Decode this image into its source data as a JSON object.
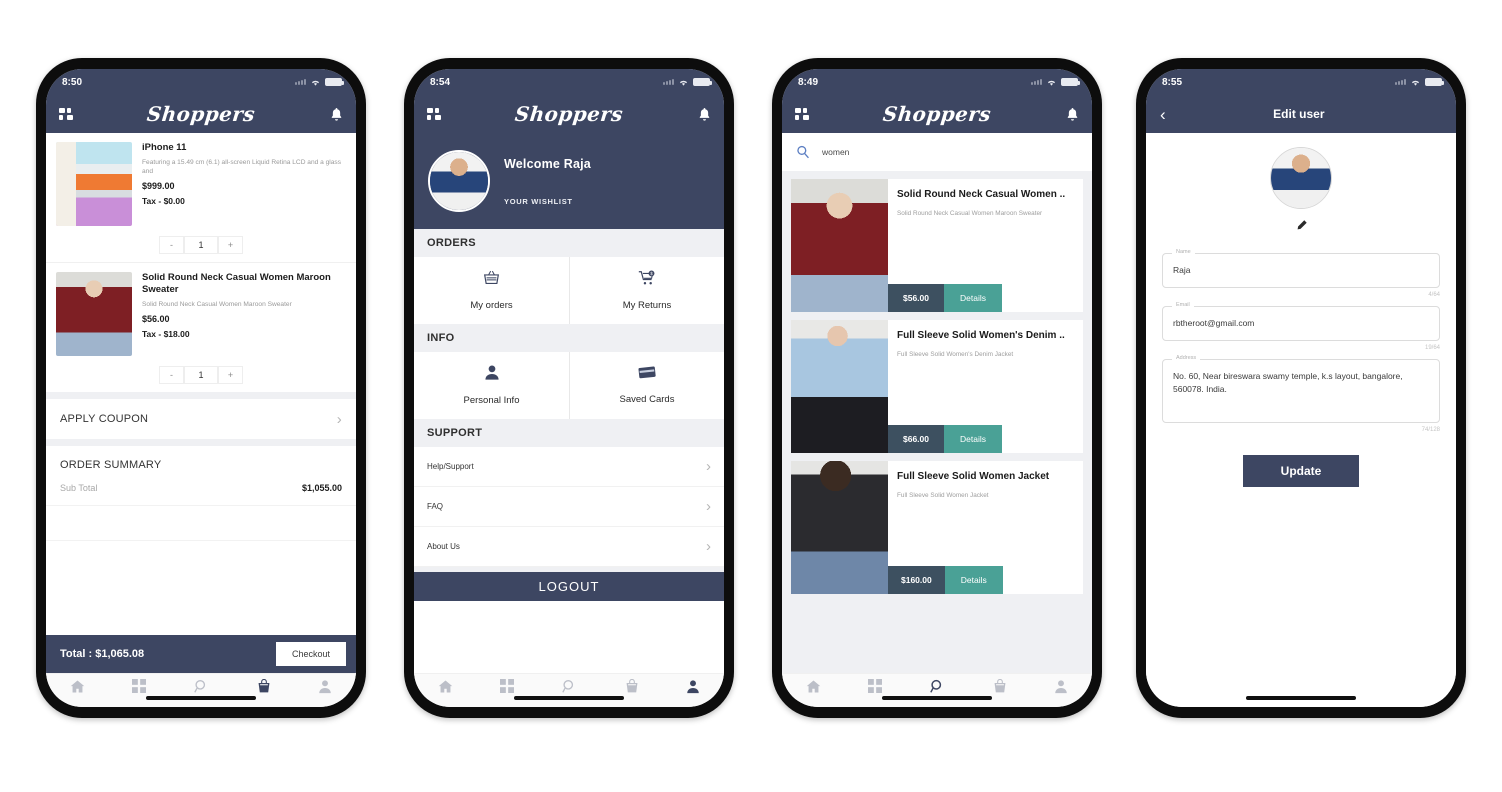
{
  "phones": [
    {
      "id": "cart",
      "status": {
        "time": "8:50",
        "wifi_icon": "wifi-icon",
        "battery_icon": "battery-icon",
        "signal_icon": "signal-icon"
      },
      "header": {
        "menu_icon": "grid-menu-icon",
        "logo": "Shoppers",
        "bell_icon": "notification-bell-icon"
      },
      "items": [
        {
          "title": "iPhone 11",
          "desc": "Featuring a 15.49 cm (6.1) all-screen Liquid Retina LCD and a glass and",
          "price": "$999.00",
          "tax": "Tax - $0.00",
          "qty": "1",
          "minus": "-",
          "plus": "+"
        },
        {
          "title": "Solid Round Neck Casual Women Maroon Sweater",
          "desc": "Solid Round Neck Casual Women Maroon Sweater",
          "price": "$56.00",
          "tax": "Tax - $18.00",
          "qty": "1",
          "minus": "-",
          "plus": "+"
        }
      ],
      "coupon_label": "APPLY COUPON",
      "summary_title": "ORDER SUMMARY",
      "summary_rows": [
        {
          "label": "Sub Total",
          "value": "$1,055.00"
        }
      ],
      "total_label": "Total : $1,065.08",
      "checkout_label": "Checkout",
      "tabs": [
        {
          "name": "home",
          "icon": "home-icon",
          "active": false
        },
        {
          "name": "categories",
          "icon": "grid-icon",
          "active": false
        },
        {
          "name": "search",
          "icon": "search-icon",
          "active": false
        },
        {
          "name": "cart",
          "icon": "cart-icon",
          "active": true
        },
        {
          "name": "profile",
          "icon": "person-icon",
          "active": false
        }
      ]
    },
    {
      "id": "profile",
      "status": {
        "time": "8:54",
        "wifi_icon": "wifi-icon",
        "battery_icon": "battery-icon",
        "signal_icon": "signal-icon"
      },
      "header": {
        "menu_icon": "grid-menu-icon",
        "logo": "Shoppers",
        "bell_icon": "notification-bell-icon"
      },
      "welcome": "Welcome Raja",
      "wishlist": "YOUR WISHLIST",
      "groups": [
        {
          "title": "ORDERS",
          "tiles": [
            {
              "label": "My orders",
              "icon": "basket-icon"
            },
            {
              "label": "My Returns",
              "icon": "return-cart-icon"
            }
          ]
        },
        {
          "title": "INFO",
          "tiles": [
            {
              "label": "Personal Info",
              "icon": "person-icon"
            },
            {
              "label": "Saved Cards",
              "icon": "credit-card-icon"
            }
          ]
        }
      ],
      "support_title": "SUPPORT",
      "support_rows": [
        {
          "label": "Help/Support"
        },
        {
          "label": "FAQ"
        },
        {
          "label": "About Us"
        }
      ],
      "logout_label": "LOGOUT",
      "tabs": [
        {
          "name": "home",
          "icon": "home-icon",
          "active": false
        },
        {
          "name": "categories",
          "icon": "grid-icon",
          "active": false
        },
        {
          "name": "search",
          "icon": "search-icon",
          "active": false
        },
        {
          "name": "cart",
          "icon": "cart-icon",
          "active": false
        },
        {
          "name": "profile",
          "icon": "person-icon",
          "active": true
        }
      ]
    },
    {
      "id": "search",
      "status": {
        "time": "8:49",
        "wifi_icon": "wifi-icon",
        "battery_icon": "battery-icon",
        "signal_icon": "signal-icon"
      },
      "header": {
        "menu_icon": "grid-menu-icon",
        "logo": "Shoppers",
        "bell_icon": "notification-bell-icon"
      },
      "search": {
        "icon": "search-icon",
        "value": "women",
        "placeholder": "Search"
      },
      "products": [
        {
          "title": "Solid Round Neck Casual Women ..",
          "desc": "Solid Round Neck Casual Women Maroon Sweater",
          "price": "$56.00",
          "details_label": "Details",
          "image": "img-sweater"
        },
        {
          "title": "Full Sleeve Solid Women's Denim ..",
          "desc": "Full Sleeve Solid Women's Denim Jacket",
          "price": "$66.00",
          "details_label": "Details",
          "image": "img-denim"
        },
        {
          "title": "Full Sleeve Solid Women Jacket",
          "desc": "Full Sleeve Solid Women Jacket",
          "price": "$160.00",
          "details_label": "Details",
          "image": "img-jacket"
        }
      ],
      "tabs": [
        {
          "name": "home",
          "icon": "home-icon",
          "active": false
        },
        {
          "name": "categories",
          "icon": "grid-icon",
          "active": false
        },
        {
          "name": "search",
          "icon": "search-icon",
          "active": true
        },
        {
          "name": "cart",
          "icon": "cart-icon",
          "active": false
        },
        {
          "name": "profile",
          "icon": "person-icon",
          "active": false
        }
      ]
    },
    {
      "id": "edit-user",
      "status": {
        "time": "8:55",
        "wifi_icon": "wifi-icon",
        "battery_icon": "battery-icon",
        "signal_icon": "signal-icon"
      },
      "header": {
        "back_icon": "back-chevron-icon",
        "title": "Edit user"
      },
      "edit_icon": "pencil-icon",
      "fields": [
        {
          "label": "Name",
          "value": "Raja",
          "counter": "4/64"
        },
        {
          "label": "Email",
          "value": "rbtheroot@gmail.com",
          "counter": "19/64"
        },
        {
          "label": "Address",
          "value": "No. 60, Near bireswara swamy temple, k.s layout, bangalore, 560078. India.",
          "counter": "74/128"
        }
      ],
      "update_label": "Update"
    }
  ],
  "colors": {
    "navy": "#3d4662",
    "teal": "#4aa196",
    "price_slate": "#3d5060",
    "page_bg": "#eff0f3"
  }
}
